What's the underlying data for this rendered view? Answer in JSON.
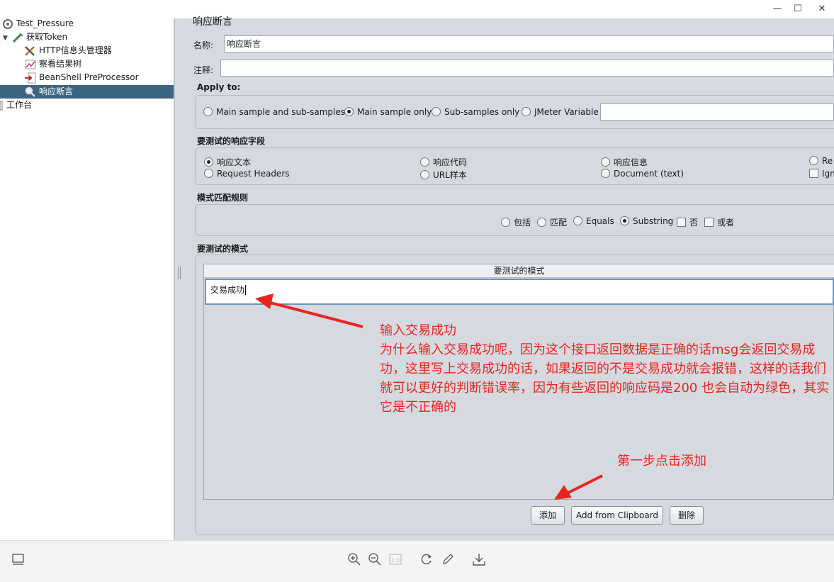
{
  "window": {
    "minimize_glyph": "—",
    "maximize_glyph": "☐",
    "close_glyph": "✕"
  },
  "tree": {
    "items": [
      {
        "label": "Test_Pressure",
        "icon": "test-plan-icon"
      },
      {
        "label": "获取Token",
        "icon": "sampler-icon"
      },
      {
        "label": "HTTP信息头管理器",
        "icon": "config-tools-icon"
      },
      {
        "label": "察看结果树",
        "icon": "chart-icon"
      },
      {
        "label": "BeanShell PreProcessor",
        "icon": "preprocessor-icon"
      },
      {
        "label": "响应断言",
        "icon": "magnifier-icon"
      },
      {
        "label": "工作台",
        "icon": "workbench-icon"
      }
    ]
  },
  "panel": {
    "title": "响应断言",
    "name_label": "名称:",
    "name_value": "响应断言",
    "comment_label": "注释:",
    "comment_value": "",
    "apply_to": {
      "heading": "Apply to:",
      "options": [
        "Main sample and sub-samples",
        "Main sample only",
        "Sub-samples only",
        "JMeter Variable"
      ],
      "selected": "Main sample only",
      "variable_value": ""
    },
    "field_to_test": {
      "heading": "要测试的响应字段",
      "options_row1": [
        "响应文本",
        "响应代码",
        "响应信息",
        "Re"
      ],
      "options_row2": [
        "Request Headers",
        "URL样本",
        "Document (text)"
      ],
      "ignore_label": "Ign",
      "selected": "响应文本"
    },
    "pattern_rules": {
      "heading": "模式匹配规则",
      "radios": [
        "包括",
        "匹配",
        "Equals",
        "Substring"
      ],
      "selected": "Substring",
      "checks": [
        "否",
        "或者"
      ]
    },
    "patterns": {
      "heading": "要测试的模式",
      "column_header": "要测试的模式",
      "rows": [
        "交易成功"
      ]
    },
    "buttons": {
      "add": "添加",
      "add_clipboard": "Add from Clipboard",
      "delete": "删除"
    }
  },
  "annotations": {
    "note1_title": "输入交易成功",
    "note1_body": "为什么输入交易成功呢，因为这个接口返回数据是正确的话msg会返回交易成功，这里写上交易成功的话，如果返回的不是交易成功就会报错，这样的话我们就可以更好的判断错误率，因为有些返回的响应码是200 也会自动为绿色，其实它是不正确的",
    "note2": "第一步点击添加",
    "color": "#e8261f"
  },
  "toolbar": {
    "icons": [
      "panel-toggle-icon",
      "zoom-in-icon",
      "zoom-out-icon",
      "actual-size-icon",
      "rotate-icon",
      "edit-icon",
      "download-icon"
    ]
  }
}
